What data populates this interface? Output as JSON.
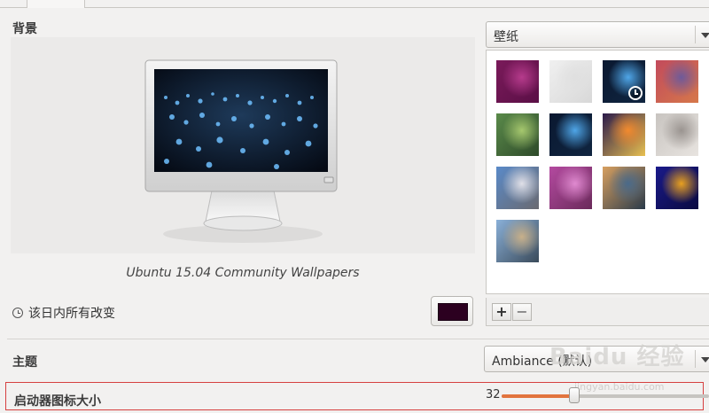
{
  "tabs": {
    "active_label": ""
  },
  "background": {
    "section_label": "背景",
    "caption": "Ubuntu 15.04 Community Wallpapers",
    "change_rule_label": "该日内所有改变",
    "solid_color": "#2c0020",
    "source_combo": {
      "value": "壁纸"
    },
    "thumbnails": [
      {
        "name": "purple-gradient",
        "colors": [
          "#7a1a5a",
          "#b63b8c",
          "#5a0f46"
        ]
      },
      {
        "name": "light-gray",
        "colors": [
          "#f0f0f0",
          "#e0e0e0",
          "#d8d8d8"
        ]
      },
      {
        "name": "blue-lights",
        "colors": [
          "#0a1830",
          "#4fa6e8",
          "#102540"
        ],
        "selected": true
      },
      {
        "name": "pink-fractal",
        "colors": [
          "#c24a5c",
          "#6e5a9a",
          "#d6784a"
        ]
      },
      {
        "name": "green-mantis",
        "colors": [
          "#5a8a4a",
          "#a6c86e",
          "#2e4a2a"
        ]
      },
      {
        "name": "blue-lights-2",
        "colors": [
          "#0a1830",
          "#4fa6e8",
          "#102540"
        ]
      },
      {
        "name": "concert-crowd",
        "colors": [
          "#2a1a4a",
          "#f28a2e",
          "#e8c050"
        ]
      },
      {
        "name": "stones",
        "colors": [
          "#c8c4c0",
          "#9a9490",
          "#e8e4e0"
        ]
      },
      {
        "name": "beach-sky",
        "colors": [
          "#5a8ac8",
          "#e0e0e8",
          "#6a6a70"
        ]
      },
      {
        "name": "pink-flower",
        "colors": [
          "#b44aa0",
          "#e08ad0",
          "#6a2a5a"
        ]
      },
      {
        "name": "sea-rocks",
        "colors": [
          "#d8a060",
          "#4a6a8a",
          "#2a3a4a"
        ]
      },
      {
        "name": "blue-orange-bokeh",
        "colors": [
          "#1a1a8a",
          "#e8a020",
          "#0a0a40"
        ]
      },
      {
        "name": "grass-sunset",
        "colors": [
          "#8ab0d8",
          "#c8b08a",
          "#3a4a5a"
        ]
      }
    ],
    "toolbar": {
      "add_label": "+",
      "remove_label": "−"
    }
  },
  "theme": {
    "section_label": "主题",
    "combo": {
      "value": "Ambiance (默认)"
    }
  },
  "launcher": {
    "section_label": "启动器图标大小",
    "value_text": "32",
    "fraction": 0.35
  },
  "watermark": {
    "main": "Baidu 经验",
    "sub": "jingyan.baidu.com"
  },
  "colors": {
    "accent": "#e2743e",
    "highlight_box": "#d64040"
  }
}
